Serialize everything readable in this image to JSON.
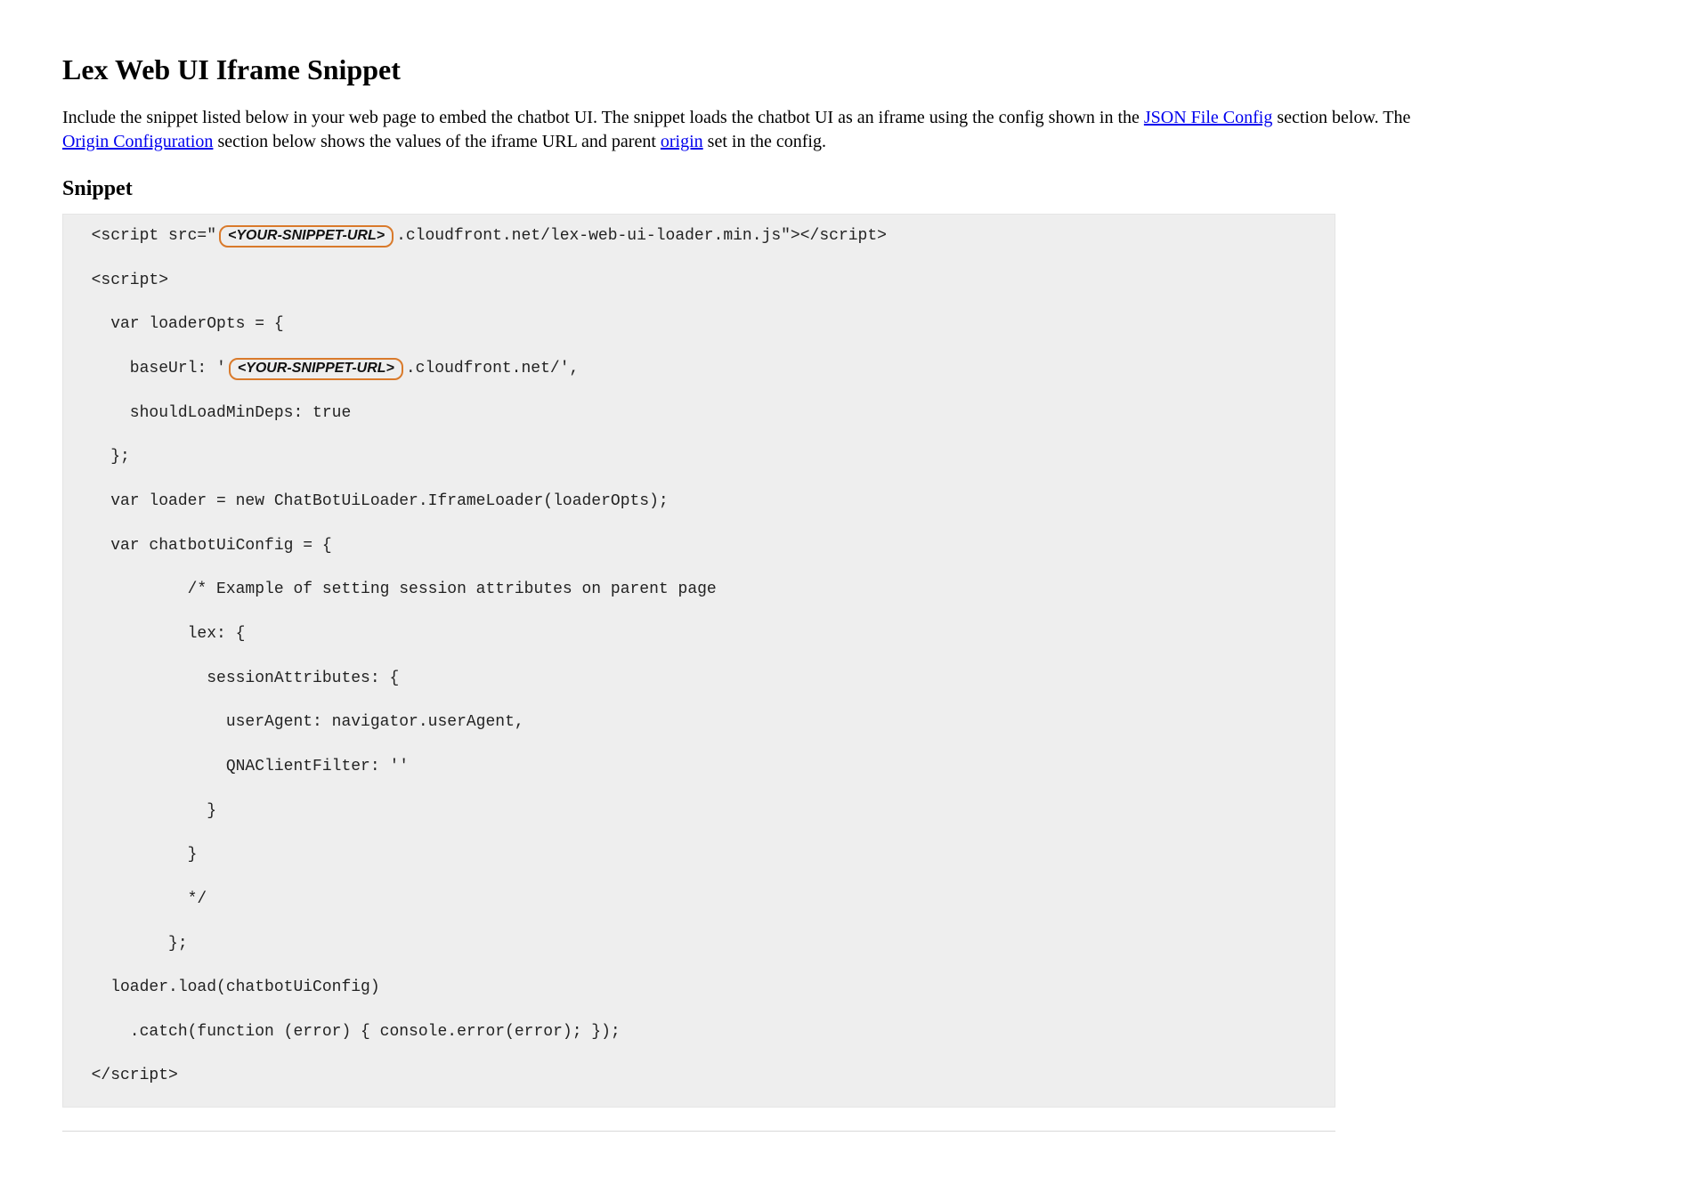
{
  "title": "Lex Web UI Iframe Snippet",
  "intro": {
    "pre1": "Include the snippet listed below in your web page to embed the chatbot UI. The snippet loads the chatbot UI as an iframe using the config shown in the ",
    "link1": "JSON File Config",
    "mid1": " section below. The ",
    "link2": "Origin Configuration",
    "mid2": " section below shows the values of the iframe URL and parent ",
    "link3": "origin",
    "post": " set in the config."
  },
  "subheading": "Snippet",
  "placeholders": {
    "snippet_url": "<YOUR-SNIPPET-URL>"
  },
  "code": {
    "l01a": "  <script src=\"",
    "l01b": ".cloudfront.net/lex-web-ui-loader.min.js\"></script>",
    "l02": "  <script>",
    "l03": "    var loaderOpts = {",
    "l04a": "      baseUrl: '",
    "l04b": ".cloudfront.net/',",
    "l05": "      shouldLoadMinDeps: true",
    "l06": "    };",
    "l07": "    var loader = new ChatBotUiLoader.IframeLoader(loaderOpts);",
    "l08": "    var chatbotUiConfig = {",
    "l09": "            /* Example of setting session attributes on parent page",
    "l10": "            lex: {",
    "l11": "              sessionAttributes: {",
    "l12": "                userAgent: navigator.userAgent,",
    "l13": "                QNAClientFilter: ''",
    "l14": "              }",
    "l15": "            }",
    "l16": "            */",
    "l17": "          };",
    "l18": "    loader.load(chatbotUiConfig)",
    "l19": "      .catch(function (error) { console.error(error); });",
    "l20": "  </script>"
  }
}
